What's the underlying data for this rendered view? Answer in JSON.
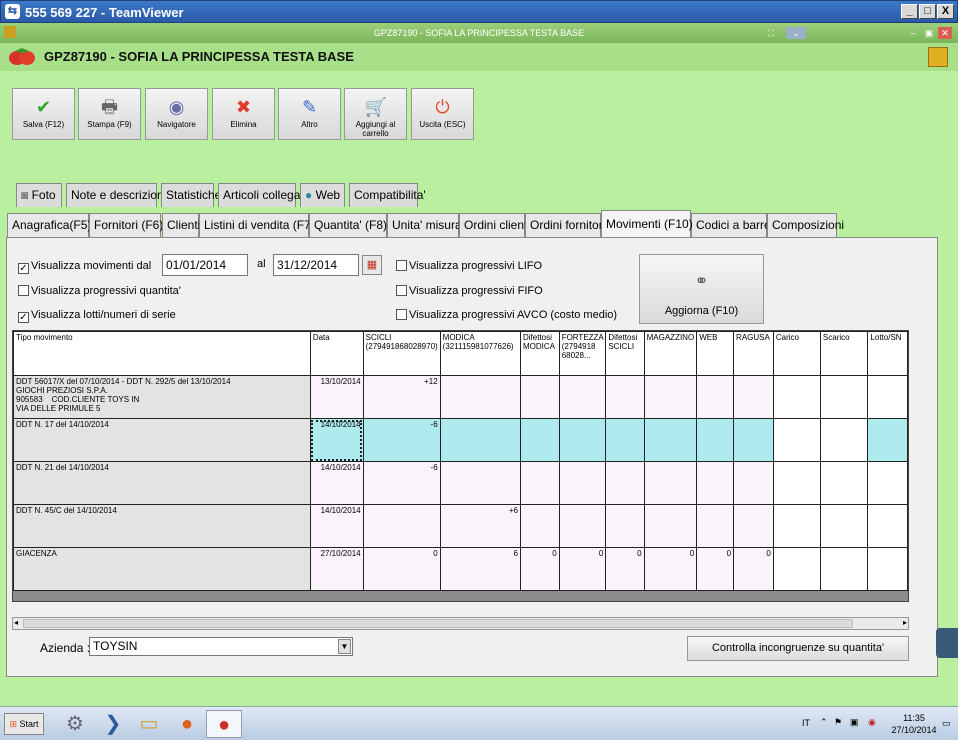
{
  "teamviewer": {
    "title": "555 569 227 - TeamViewer",
    "min": "_",
    "max": "□",
    "close": "X"
  },
  "app_window": {
    "title": "GPZ87190 - SOFIA LA PRINCIPESSA TESTA BASE"
  },
  "header": {
    "title": "GPZ87190 - SOFIA LA PRINCIPESSA TESTA BASE"
  },
  "toolbar": [
    {
      "label": "Salva (F12)",
      "icon": "✔",
      "color": "#2eaa2e",
      "name": "save-button",
      "icon_name": "checkmark-icon"
    },
    {
      "label": "Stampa (F9)",
      "icon": "🖶",
      "color": "#666666",
      "name": "print-button",
      "icon_name": "printer-icon"
    },
    {
      "label": "Navigatore",
      "icon": "◉",
      "color": "#6a6aa8",
      "name": "navigator-button",
      "icon_name": "navigator-icon"
    },
    {
      "label": "Elimina",
      "icon": "✖",
      "color": "#e03a2a",
      "name": "delete-button",
      "icon_name": "delete-icon"
    },
    {
      "label": "Altro",
      "icon": "✎",
      "color": "#3a6ad0",
      "name": "other-button",
      "icon_name": "other-icon"
    },
    {
      "label": "Aggiungi al carrello",
      "icon": "🛒",
      "color": "#777777",
      "name": "add-to-cart-button",
      "icon_name": "cart-icon"
    },
    {
      "label": "Uscita (ESC)",
      "icon": "⏻",
      "color": "#e04a2a",
      "name": "exit-button",
      "icon_name": "exit-icon"
    }
  ],
  "top_tabs": [
    "Foto",
    "Note e descrizioni",
    "Statistiche",
    "Articoli collegati",
    "Web",
    "Compatibilita'"
  ],
  "bottom_tabs": [
    "Anagrafica(F5)",
    "Fornitori (F6)",
    "Clienti",
    "Listini di vendita (F7)",
    "Quantita' (F8)",
    "Unita' misura",
    "Ordini clienti",
    "Ordini fornitori",
    "Movimenti (F10)",
    "Codici a barre",
    "Composizioni"
  ],
  "filters": {
    "show_movements_label": "Visualizza movimenti dal",
    "show_movements_checked": true,
    "date_from": "01/01/2014",
    "al_label": "al",
    "date_to": "31/12/2014",
    "prog_qty_label": "Visualizza progressivi quantita'",
    "prog_qty_checked": false,
    "lots_label": "Visualizza lotti/numeri di serie",
    "lots_checked": true,
    "lifo_label": "Visualizza progressivi LIFO",
    "fifo_label": "Visualizza progressivi FIFO",
    "avco_label": "Visualizza progressivi AVCO (costo medio)",
    "refresh_label": "Aggiorna (F10)"
  },
  "grid": {
    "columns": [
      "Tipo movimento",
      "Data",
      "SCICLI (279491868028970)",
      "MODICA (321115981077626)",
      "Difettosi MODICA",
      "FORTEZZA (2794918 68028...",
      "Difettosi SCICLI",
      "MAGAZZINO",
      "WEB",
      "RAGUSA",
      "Carico",
      "Scarico",
      "Lotto/SN"
    ],
    "rows": [
      {
        "tipo": "DDT 56017/X del 07/10/2014 - DDT N. 292/5 del 13/10/2014\nGIOCHI PREZIOSI S.P.A.\n905583    COD.CLIENTE TOYS IN\nVIA DELLE PRIMULE 5",
        "data": "13/10/2014",
        "vals": [
          "+12",
          "",
          "",
          "",
          "",
          "",
          "",
          ""
        ]
      },
      {
        "tipo": "DDT N. 17 del 14/10/2014",
        "data": "14/10/2014",
        "vals": [
          "-6",
          "",
          "",
          "",
          "",
          "",
          "",
          ""
        ],
        "selected": true
      },
      {
        "tipo": "DDT N. 21 del 14/10/2014",
        "data": "14/10/2014",
        "vals": [
          "-6",
          "",
          "",
          "",
          "",
          "",
          "",
          ""
        ]
      },
      {
        "tipo": "DDT N. 45/C del 14/10/2014",
        "data": "14/10/2014",
        "vals": [
          "",
          "+6",
          "",
          "",
          "",
          "",
          "",
          ""
        ]
      },
      {
        "tipo": "GIACENZA",
        "data": "27/10/2014",
        "vals": [
          "0",
          "6",
          "0",
          "0",
          "0",
          "0",
          "0",
          "0"
        ]
      }
    ]
  },
  "footer": {
    "azienda_label": "Azienda :",
    "azienda_value": "TOYSIN",
    "check_button": "Controlla incongruenze su quantita'"
  },
  "taskbar": {
    "start": "Start",
    "lang": "IT",
    "time": "11:35",
    "date": "27/10/2014"
  }
}
